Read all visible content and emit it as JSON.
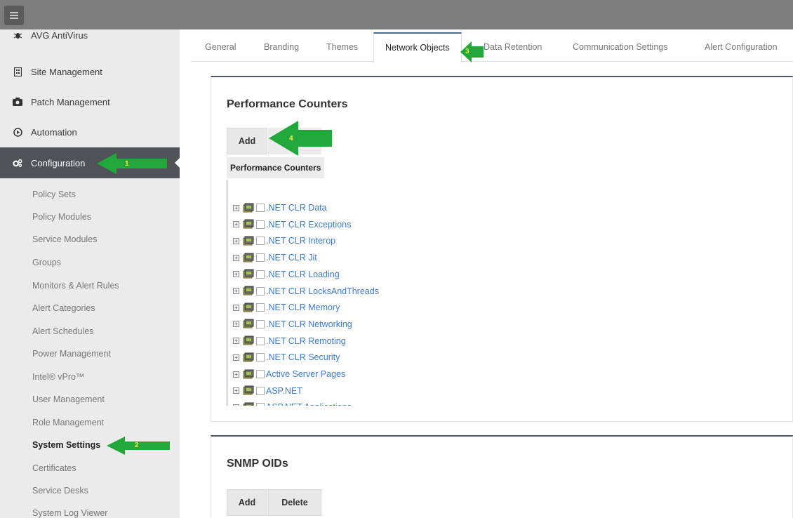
{
  "topbar": {
    "menu_icon": "hamburger-icon"
  },
  "sidebar": {
    "items": [
      {
        "label": "AVG AntiVirus",
        "icon": "bug-icon"
      },
      {
        "label": "Site Management",
        "icon": "building-icon"
      },
      {
        "label": "Patch Management",
        "icon": "camera-icon"
      },
      {
        "label": "Automation",
        "icon": "play-circle-icon"
      },
      {
        "label": "Configuration",
        "icon": "gears-icon"
      }
    ],
    "sub_items": [
      "Policy Sets",
      "Policy Modules",
      "Service Modules",
      "Groups",
      "Monitors & Alert Rules",
      "Alert Categories",
      "Alert Schedules",
      "Power Management",
      "Intel® vPro™",
      "User Management",
      "Role Management",
      "System Settings",
      "Certificates",
      "Service Desks",
      "System Log Viewer"
    ],
    "current_sub_item": "System Settings"
  },
  "tabs": [
    "General",
    "Branding",
    "Themes",
    "Network Objects",
    "Data Retention",
    "Communication Settings",
    "Alert Configuration"
  ],
  "active_tab": "Network Objects",
  "performance_counters": {
    "title": "Performance Counters",
    "add_label": "Add",
    "list_header": "Performance Counters",
    "tree_items": [
      ".NET CLR Data",
      ".NET CLR Exceptions",
      ".NET CLR Interop",
      ".NET CLR Jit",
      ".NET CLR Loading",
      ".NET CLR LocksAndThreads",
      ".NET CLR Memory",
      ".NET CLR Networking",
      ".NET CLR Remoting",
      ".NET CLR Security",
      "Active Server Pages",
      "ASP.NET",
      "ASP.NET Applications"
    ]
  },
  "snmp_oids": {
    "title": "SNMP OIDs",
    "add_label": "Add",
    "delete_label": "Delete"
  },
  "callouts": [
    "1",
    "2",
    "3",
    "4"
  ],
  "colors": {
    "topbar": "#7d7d7d",
    "sidebar_bg": "#ebebeb",
    "active_nav": "#4f5357",
    "link": "#3f7cc2",
    "arrow_green": "#22a83a",
    "tab_accent": "#3c6fa8"
  }
}
